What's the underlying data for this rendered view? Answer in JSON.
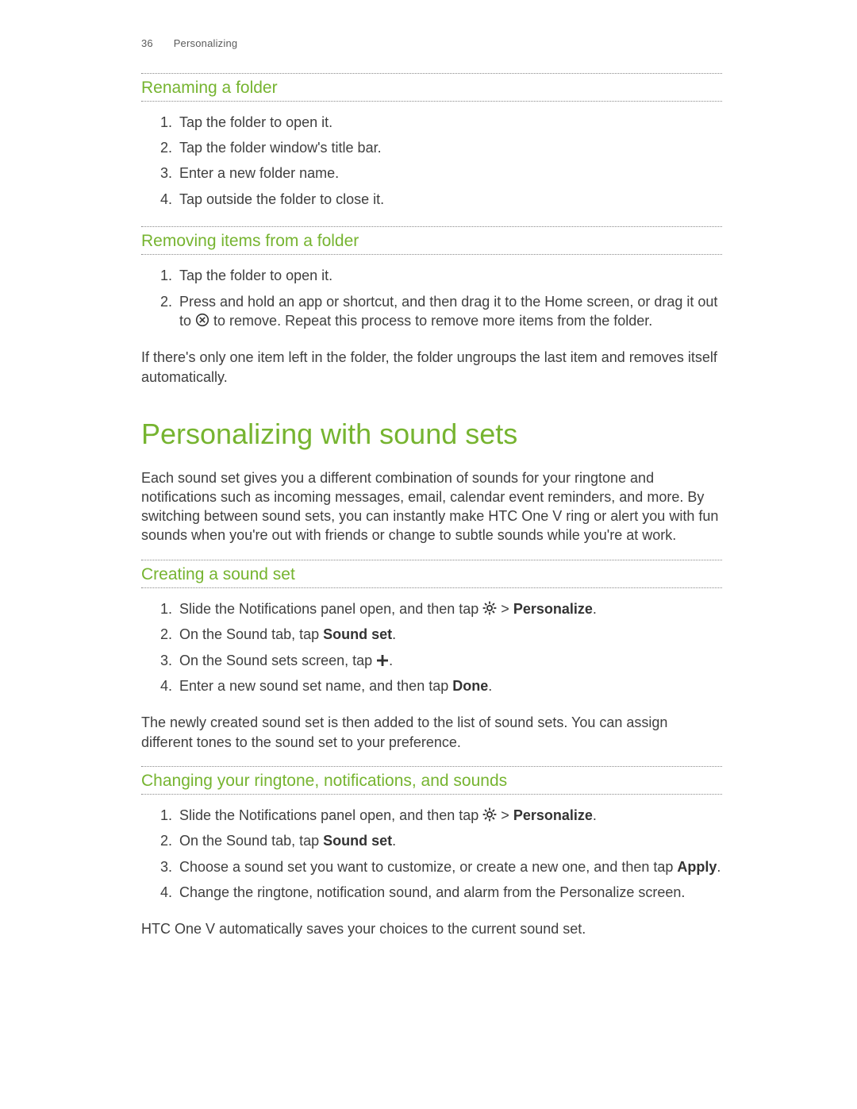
{
  "header": {
    "page_number": "36",
    "section_name": "Personalizing"
  },
  "sections": {
    "renaming": {
      "title": "Renaming a folder",
      "steps": [
        "Tap the folder to open it.",
        "Tap the folder window's title bar.",
        "Enter a new folder name.",
        "Tap outside the folder to close it."
      ]
    },
    "removing": {
      "title": "Removing items from a folder",
      "step1": "Tap the folder to open it.",
      "step2_a": "Press and hold an app or shortcut, and then drag it to the Home screen, or drag it out to ",
      "step2_b": " to remove. Repeat this process to remove more items from the folder.",
      "note": "If there's only one item left in the folder, the folder ungroups the last item and removes itself automatically."
    },
    "sound_sets": {
      "title": "Personalizing with sound sets",
      "intro": "Each sound set gives you a different combination of sounds for your ringtone and notifications such as incoming messages, email, calendar event reminders, and more. By switching between sound sets, you can instantly make HTC One V ring or alert you with fun sounds when you're out with friends or change to subtle sounds while you're at work."
    },
    "creating": {
      "title": "Creating a sound set",
      "s1_a": "Slide the Notifications panel open, and then tap ",
      "s1_b": " > ",
      "s1_personalize": "Personalize",
      "s1_c": ".",
      "s2_a": "On the Sound tab, tap ",
      "s2_bold": "Sound set",
      "s2_b": ".",
      "s3_a": "On the Sound sets screen, tap ",
      "s3_b": ".",
      "s4_a": "Enter a new sound set name, and then tap ",
      "s4_bold": "Done",
      "s4_b": ".",
      "note": "The newly created sound set is then added to the list of sound sets. You can assign different tones to the sound set to your preference."
    },
    "changing": {
      "title": "Changing your ringtone, notifications, and sounds",
      "s1_a": "Slide the Notifications panel open, and then tap ",
      "s1_b": " > ",
      "s1_personalize": "Personalize",
      "s1_c": ".",
      "s2_a": "On the Sound tab, tap ",
      "s2_bold": "Sound set",
      "s2_b": ".",
      "s3_a": "Choose a sound set you want to customize, or create a new one, and then tap ",
      "s3_bold": "Apply",
      "s3_b": ".",
      "s4": "Change the ringtone, notification sound, and alarm from the Personalize screen.",
      "note": "HTC One V automatically saves your choices to the current sound set."
    }
  }
}
